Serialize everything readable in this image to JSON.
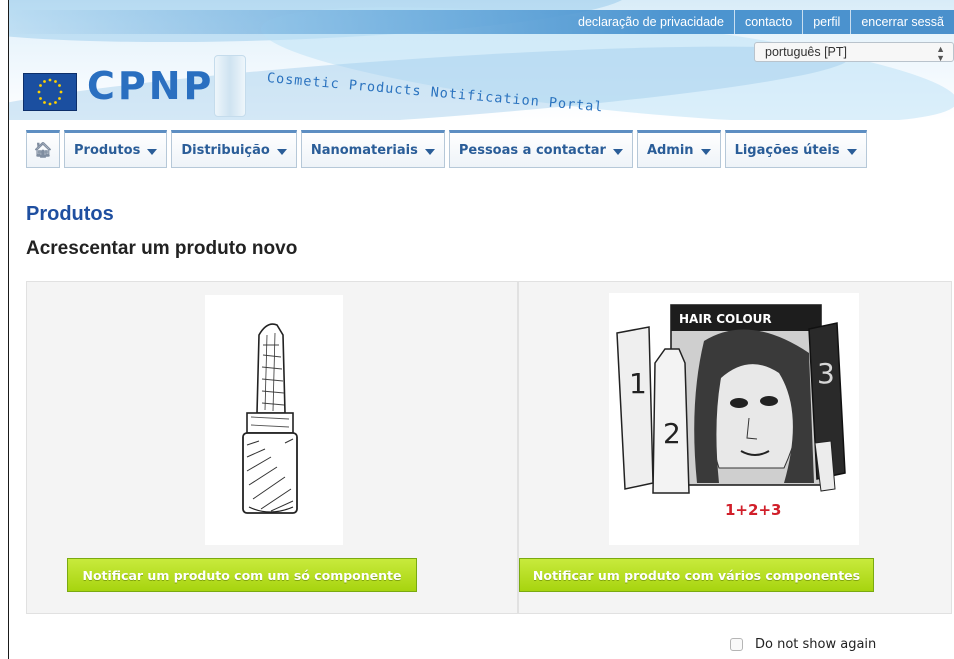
{
  "header": {
    "top_links": [
      "declaração de privacidade",
      "contacto",
      "perfil",
      "encerrar sessã"
    ],
    "language_select": {
      "value": "português [PT]"
    },
    "logo_text": "CPNP",
    "tagline": "Cosmetic Products Notification Portal"
  },
  "nav": {
    "home_icon": "home-icon",
    "items": [
      {
        "label": "Produtos"
      },
      {
        "label": "Distribuição"
      },
      {
        "label": "Nanomateriais"
      },
      {
        "label": "Pessoas a contactar"
      },
      {
        "label": "Admin"
      },
      {
        "label": "Ligações úteis"
      }
    ]
  },
  "page": {
    "title": "Produtos",
    "subtitle": "Acrescentar um produto novo"
  },
  "options": [
    {
      "button_label": "Notificar um produto com um só componente"
    },
    {
      "button_label": "Notificar um produto com vários componentes",
      "box_title": "HAIR COLOUR",
      "numbers": [
        "1",
        "2",
        "3"
      ],
      "formula": "1+2+3"
    }
  ],
  "footer": {
    "dont_show_label": "Do not show again",
    "checkbox_checked": false
  },
  "colors": {
    "accent_blue": "#2a5d98",
    "heading_blue": "#1f4fa0",
    "button_green": "#a7d40f",
    "formula_red": "#d11f2a"
  }
}
